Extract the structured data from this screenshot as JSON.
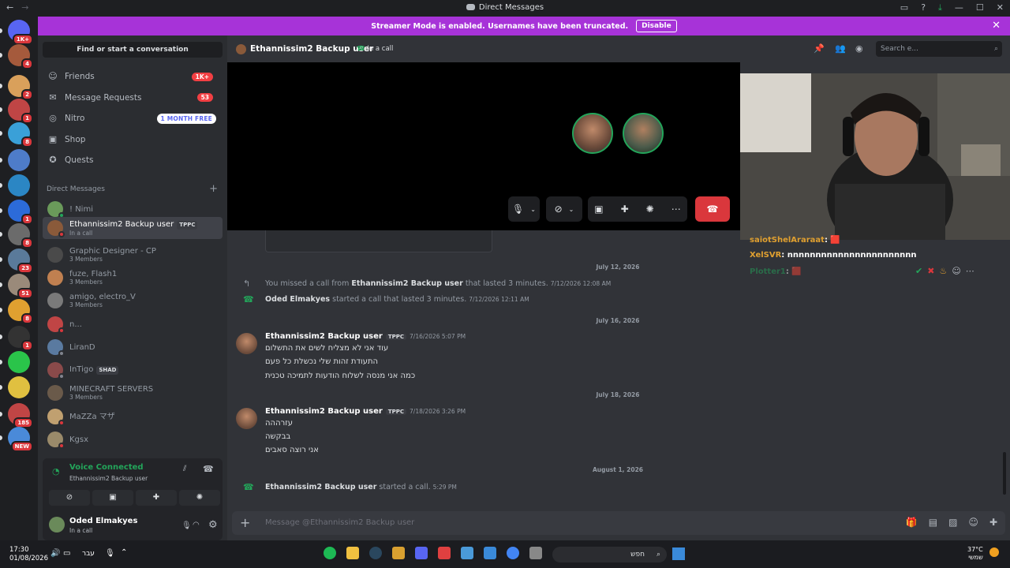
{
  "window": {
    "title": "Direct Messages",
    "back": "←",
    "forward": "→"
  },
  "banner": {
    "text": "Streamer Mode is enabled. Usernames have been truncated.",
    "disable_label": "Disable",
    "close": "✕"
  },
  "guilds": [
    {
      "badge": "1K+",
      "color": "#5865f2"
    },
    {
      "badge": "4",
      "color": "#a55a3c"
    },
    {
      "badge": "2",
      "color": "#d9a05b"
    },
    {
      "badge": "1",
      "color": "#c04545"
    },
    {
      "badge": "8",
      "color": "#3aa0d8"
    },
    {
      "badge": "",
      "color": "#4e7cc9"
    },
    {
      "badge": "",
      "color": "#2b86c4"
    },
    {
      "badge": "1",
      "color": "#2c6bd9"
    },
    {
      "badge": "8",
      "color": "#6b6b6b"
    },
    {
      "badge": "23",
      "color": "#5a7a9a"
    },
    {
      "badge": "51",
      "color": "#9a8a7a"
    },
    {
      "badge": "8",
      "color": "#e0a030"
    },
    {
      "badge": "1",
      "color": "#333"
    },
    {
      "badge": "",
      "color": "#2ac44a"
    },
    {
      "badge": "",
      "color": "#e0c040"
    },
    {
      "badge": "185",
      "color": "#c04545"
    },
    {
      "badge": "NEW",
      "color": "#4a8ad9"
    }
  ],
  "sidebar": {
    "find": "Find or start a conversation",
    "nav": [
      {
        "label": "Friends",
        "icon": "friends-icon",
        "glyph": "☺",
        "count": "1K+"
      },
      {
        "label": "Message Requests",
        "icon": "mail-icon",
        "glyph": "✉",
        "count": "53"
      },
      {
        "label": "Nitro",
        "icon": "nitro-icon",
        "glyph": "◎",
        "promo": "1 MONTH FREE"
      },
      {
        "label": "Shop",
        "icon": "shop-icon",
        "glyph": "▣"
      },
      {
        "label": "Quests",
        "icon": "quests-icon",
        "glyph": "✪"
      }
    ],
    "dm_header": "Direct Messages",
    "dm_plus": "+",
    "dms": [
      {
        "name": "! Nimi",
        "sub": "",
        "tag": "",
        "color": "#6a9a5a",
        "status": "#23a55a"
      },
      {
        "name": "Ethannissim2 Backup user",
        "sub": "In a call",
        "tag": "TPPC",
        "color": "#8a5a3a",
        "status": "#da373c",
        "active": true
      },
      {
        "name": "Graphic Designer - CP",
        "sub": "3 Members",
        "tag": "",
        "color": "#4a4a4a",
        "status": ""
      },
      {
        "name": "fuze, Flash1",
        "sub": "3 Members",
        "tag": "",
        "color": "#c08050",
        "status": ""
      },
      {
        "name": "amigo, electro_V",
        "sub": "3 Members",
        "tag": "",
        "color": "#7a7a7a",
        "status": ""
      },
      {
        "name": "n...",
        "sub": "",
        "tag": "",
        "color": "#c04545",
        "status": "#da373c"
      },
      {
        "name": "LiranD",
        "sub": "",
        "tag": "",
        "color": "#5a7aa0",
        "status": "#80848e"
      },
      {
        "name": "InTigo",
        "sub": "",
        "tag": "SHAD",
        "color": "#8a4a4a",
        "status": "#80848e"
      },
      {
        "name": "MINECRAFT SERVERS",
        "sub": "3 Members",
        "tag": "",
        "color": "#6a5a4a",
        "status": ""
      },
      {
        "name": "MaZZa マザ",
        "sub": "",
        "tag": "",
        "color": "#c0a070",
        "status": "#da373c"
      },
      {
        "name": "Kgsx",
        "sub": "",
        "tag": "",
        "color": "#9a8a6a",
        "status": "#da373c"
      }
    ],
    "voice": {
      "title": "Voice Connected",
      "sub": "Ethannissim2 Backup user"
    },
    "user": {
      "name": "Oded Elmakyes",
      "sub": "In a call"
    }
  },
  "header": {
    "name": "Ethannissim2 Backup user",
    "call_status": "In a call",
    "search_placeholder": "Search e..."
  },
  "stream_chat": [
    {
      "user": "saiotShelAraraat",
      "text": ": 🟥",
      "color": "#e0a030"
    },
    {
      "user": "XelSVR",
      "text": ": nnnnnnnnnnnnnnnnnnnnnnn",
      "color": "#e0a030"
    },
    {
      "user": "Plotter1",
      "text": ": 🟥",
      "color": "#23a55a"
    }
  ],
  "messages": {
    "date1": "July 12, 2026",
    "missed": {
      "prefix": "You missed a call from",
      "user": "Ethannissim2 Backup user",
      "suffix": "that lasted 3 minutes.",
      "ts": "7/12/2026 12:08 AM"
    },
    "started1": {
      "user": "Oded Elmakyes",
      "suffix": "started a call that lasted 3 minutes.",
      "ts": "7/12/2026 12:11 AM"
    },
    "date2": "July 16, 2026",
    "group1": {
      "user": "Ethannissim2 Backup user",
      "tag": "TPPC",
      "ts": "7/16/2026 5:07 PM",
      "lines": [
        "עוד אני לא מצליח לשים את התשלום",
        "התעודת זהות שלי נכשלת כל פעם",
        "כמה אני מנסה לשלוח הודעות לתמיכה טכנית"
      ]
    },
    "date3": "July 18, 2026",
    "group2": {
      "user": "Ethannissim2 Backup user",
      "tag": "TPPC",
      "ts": "7/18/2026 3:26 PM",
      "lines": [
        "עזרההה",
        "בבקשה",
        "אני רוצה סאבים"
      ]
    },
    "date4": "August 1, 2026",
    "started2": {
      "user": "Ethannissim2 Backup user",
      "suffix": "started a call.",
      "ts": "5:29 PM"
    }
  },
  "composer": {
    "placeholder": "Message @Ethannissim2 Backup user",
    "plus": "+"
  },
  "taskbar": {
    "time": "17:30",
    "date": "01/08/2026",
    "lang": "עבר",
    "search": "חפש",
    "temp": "37°C",
    "weather": "שמשי"
  }
}
